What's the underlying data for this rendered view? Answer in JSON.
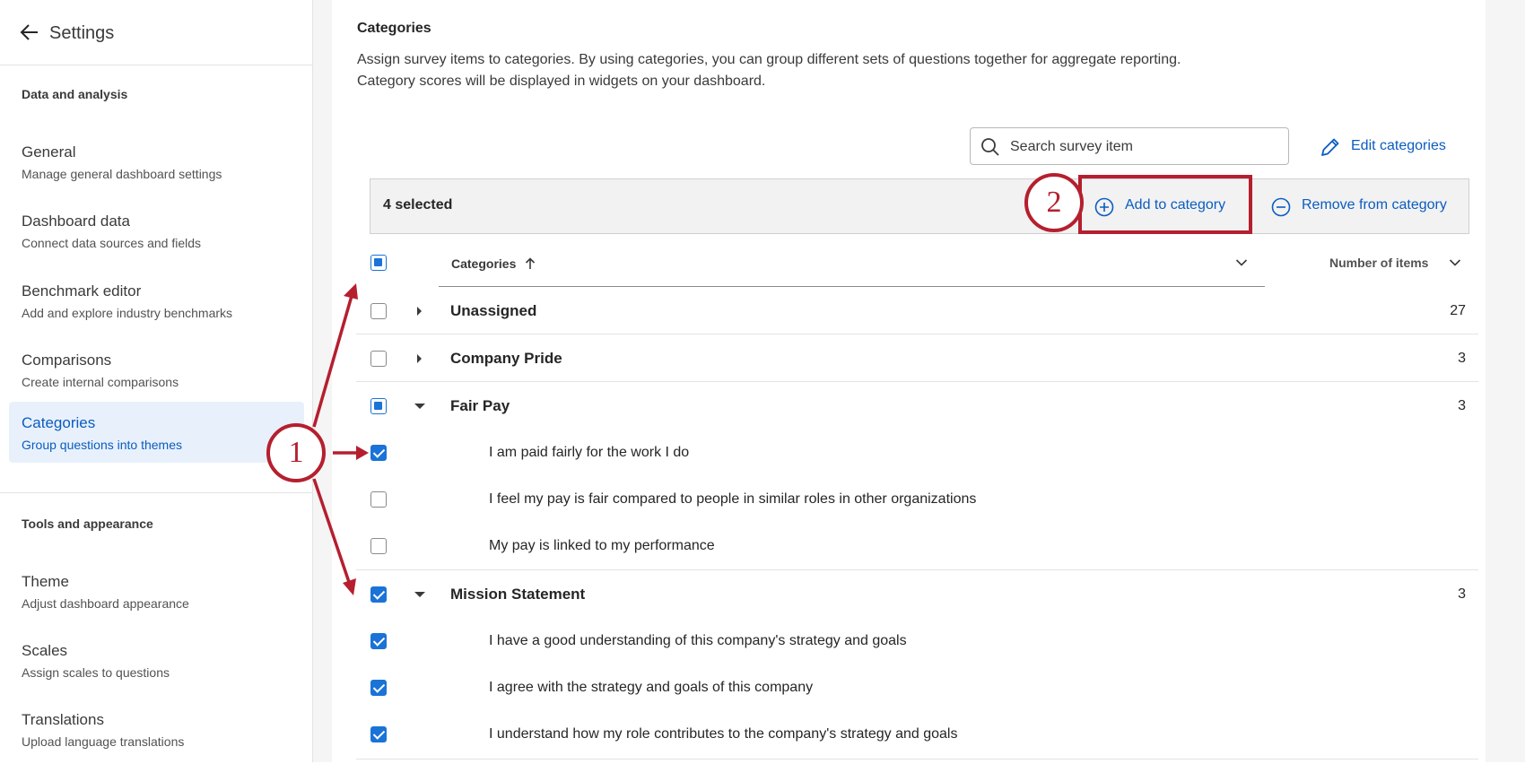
{
  "sidebar": {
    "title": "Settings",
    "section1": "Data and analysis",
    "section2": "Tools and appearance",
    "items": [
      {
        "label": "General",
        "sub": "Manage general dashboard settings"
      },
      {
        "label": "Dashboard data",
        "sub": "Connect data sources and fields"
      },
      {
        "label": "Benchmark editor",
        "sub": "Add and explore industry benchmarks"
      },
      {
        "label": "Comparisons",
        "sub": "Create internal comparisons"
      },
      {
        "label": "Categories",
        "sub": "Group questions into themes"
      },
      {
        "label": "Theme",
        "sub": "Adjust dashboard appearance"
      },
      {
        "label": "Scales",
        "sub": "Assign scales to questions"
      },
      {
        "label": "Translations",
        "sub": "Upload language translations"
      }
    ]
  },
  "main": {
    "title": "Categories",
    "desc_line1": "Assign survey items to categories. By using categories, you can group different sets of questions together for aggregate reporting.",
    "desc_line2": "Category scores will be displayed in widgets on your dashboard.",
    "search_placeholder": "Search survey item",
    "edit_categories": "Edit categories",
    "selected_text": "4 selected",
    "add_to_category": "Add to category",
    "remove_from_category": "Remove from category",
    "col_categories": "Categories",
    "col_number": "Number of items"
  },
  "rows": [
    {
      "type": "category",
      "name": "Unassigned",
      "count": "27",
      "state": "unchecked",
      "expanded": false
    },
    {
      "type": "category",
      "name": "Company Pride",
      "count": "3",
      "state": "unchecked",
      "expanded": false
    },
    {
      "type": "category",
      "name": "Fair Pay",
      "count": "3",
      "state": "partial",
      "expanded": true
    },
    {
      "type": "item",
      "text": "I am paid fairly for the work I do",
      "state": "checked"
    },
    {
      "type": "item",
      "text": "I feel my pay is fair compared to people in similar roles in other organizations",
      "state": "unchecked"
    },
    {
      "type": "item",
      "text": "My pay is linked to my performance",
      "state": "unchecked"
    },
    {
      "type": "category",
      "name": "Mission Statement",
      "count": "3",
      "state": "checked",
      "expanded": true
    },
    {
      "type": "item",
      "text": "I have a good understanding of this company's strategy and goals",
      "state": "checked"
    },
    {
      "type": "item",
      "text": "I agree with the strategy and goals of this company",
      "state": "checked"
    },
    {
      "type": "item",
      "text": "I understand how my role contributes to the company's strategy and goals",
      "state": "checked"
    }
  ],
  "annotations": {
    "step1": "1",
    "step2": "2",
    "color": "#b51f2e"
  },
  "colors": {
    "accent": "#0b5cc0",
    "checkbox": "#1a73d6",
    "active_bg": "#e8f1fb"
  }
}
